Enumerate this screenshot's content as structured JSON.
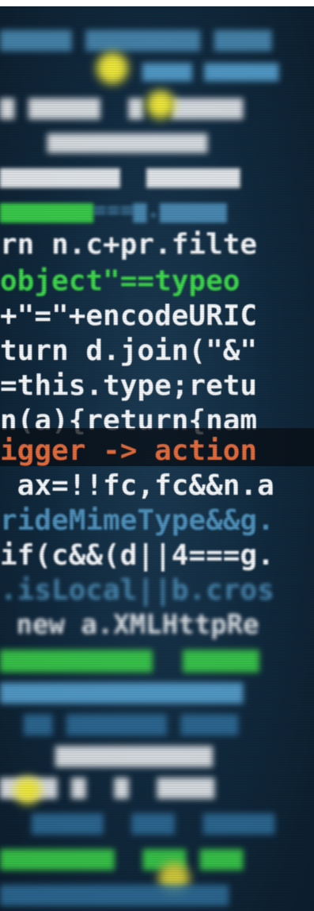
{
  "image": {
    "subject": "close-up photo of code on a screen, blurred at top and bottom",
    "colors": {
      "background": "#10283c",
      "keyword_white": "#f2f4f6",
      "identifier_blue": "#4d8fb8",
      "string_green": "#3dd64a",
      "comment_orange": "#e06a3c",
      "number_yellow": "#f3e24a"
    }
  },
  "code_lines": {
    "l01": "rn n.c+pr.filte",
    "l02": "object\"==typeo",
    "l03": "+\"=\"+encodeURIC",
    "l04": "turn d.join(\"&\"",
    "l05": "=this.type;retu",
    "l06": "n(a){return{nam",
    "l07": "igger -> action",
    "l08": " ax=!!fc,fc&&n.a",
    "l09": "rideMimeType&&g.",
    "l10": "if(c&&(d||4===g.",
    "l11": ".isLocal||b.cros",
    "l12": " new a.XMLHttpRe"
  }
}
